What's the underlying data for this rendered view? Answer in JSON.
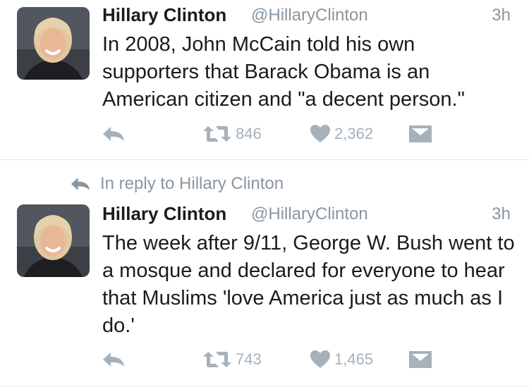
{
  "tweets": [
    {
      "author_name": "Hillary Clinton",
      "author_handle": "@HillaryClinton",
      "time": "3h",
      "text": "In 2008, John McCain told his own supporters that Barack Obama is an American citizen and \"a decent person.\"",
      "retweets": "846",
      "likes": "2,362"
    },
    {
      "reply_context": "In reply to Hillary Clinton",
      "author_name": "Hillary Clinton",
      "author_handle": "@HillaryClinton",
      "time": "3h",
      "text": "The week after 9/11, George W. Bush went to a mosque and declared for everyone to hear that Muslims 'love America just as much as I do.'",
      "retweets": "743",
      "likes": "1,465"
    }
  ],
  "icons": {
    "reply": "reply-icon",
    "retweet": "retweet-icon",
    "like": "heart-icon",
    "message": "envelope-icon"
  },
  "colors": {
    "text": "#1b1b1b",
    "muted": "#8a96a0",
    "action": "#a6b1ba",
    "divider": "#e1e6ea"
  }
}
